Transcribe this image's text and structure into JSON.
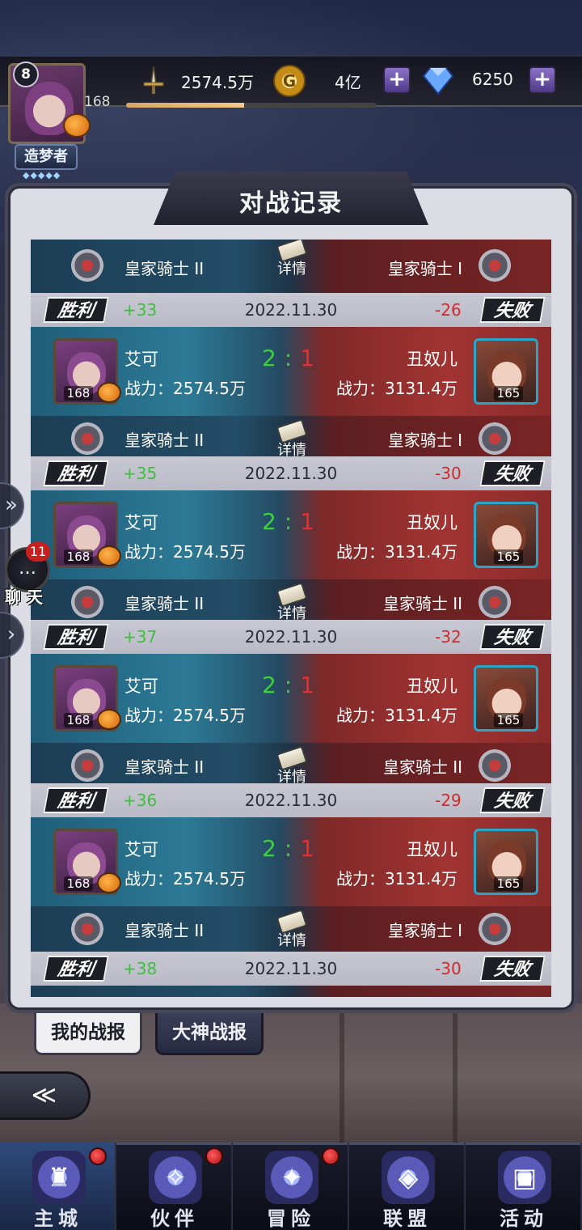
{
  "header": {
    "vip_level": "8",
    "player_level": "168",
    "player_title": "造梦者",
    "exp_progress": 0.47,
    "power": "2574.5万",
    "gold": "4亿",
    "diamonds": "6250",
    "plus_symbol": "+"
  },
  "panel": {
    "title": "对战记录"
  },
  "partial_top": {
    "detail_label": "详情",
    "left_rank": "皇家骑士 II",
    "right_rank": "皇家骑士 I"
  },
  "records": [
    {
      "result_strip": {
        "win": "胜利",
        "gain": "+33",
        "date": "2022.11.30",
        "loss": "-26",
        "lose": "失败"
      },
      "left": {
        "name": "艾可",
        "level": "168",
        "power": "战力：2574.5万",
        "rank": "皇家骑士 II"
      },
      "right": {
        "name": "丑奴儿",
        "level": "165",
        "power": "战力：3131.4万",
        "rank": "皇家骑士 I"
      },
      "score": {
        "left": "2",
        "colon": ":",
        "right": "1"
      },
      "detail_label": "详情"
    },
    {
      "result_strip": {
        "win": "胜利",
        "gain": "+35",
        "date": "2022.11.30",
        "loss": "-30",
        "lose": "失败"
      },
      "left": {
        "name": "艾可",
        "level": "168",
        "power": "战力：2574.5万",
        "rank": "皇家骑士 II"
      },
      "right": {
        "name": "丑奴儿",
        "level": "165",
        "power": "战力：3131.4万",
        "rank": "皇家骑士 II"
      },
      "score": {
        "left": "2",
        "colon": ":",
        "right": "1"
      },
      "detail_label": "详情"
    },
    {
      "result_strip": {
        "win": "胜利",
        "gain": "+37",
        "date": "2022.11.30",
        "loss": "-32",
        "lose": "失败"
      },
      "left": {
        "name": "艾可",
        "level": "168",
        "power": "战力：2574.5万",
        "rank": "皇家骑士 II"
      },
      "right": {
        "name": "丑奴儿",
        "level": "165",
        "power": "战力：3131.4万",
        "rank": "皇家骑士 II"
      },
      "score": {
        "left": "2",
        "colon": ":",
        "right": "1"
      },
      "detail_label": "详情"
    },
    {
      "result_strip": {
        "win": "胜利",
        "gain": "+36",
        "date": "2022.11.30",
        "loss": "-29",
        "lose": "失败"
      },
      "left": {
        "name": "艾可",
        "level": "168",
        "power": "战力：2574.5万",
        "rank": "皇家骑士 II"
      },
      "right": {
        "name": "丑奴儿",
        "level": "165",
        "power": "战力：3131.4万",
        "rank": "皇家骑士 I"
      },
      "score": {
        "left": "2",
        "colon": ":",
        "right": "1"
      },
      "detail_label": "详情"
    }
  ],
  "last_strip": {
    "win": "胜利",
    "gain": "+38",
    "date": "2022.11.30",
    "loss": "-30",
    "lose": "失败"
  },
  "tabs": {
    "my_reports": "我的战报",
    "top_reports": "大神战报"
  },
  "chat": {
    "badge": "11",
    "label": "聊 天"
  },
  "nav": [
    {
      "label": "主城",
      "icon": "castle-icon"
    },
    {
      "label": "伙伴",
      "icon": "hat-icon"
    },
    {
      "label": "冒险",
      "icon": "compass-icon"
    },
    {
      "label": "联盟",
      "icon": "shield-icon"
    },
    {
      "label": "活动",
      "icon": "cards-icon"
    }
  ]
}
